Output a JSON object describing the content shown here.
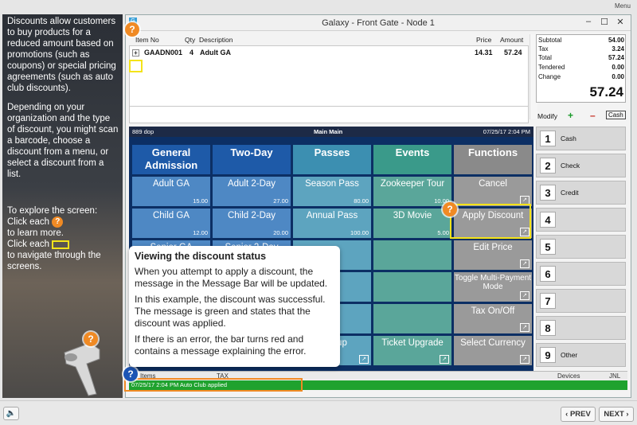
{
  "menu_link": "Menu",
  "left_panel": {
    "paragraph1": "Discounts allow customers to buy products for a reduced amount based on promotions (such as coupons) or special pricing agreements (such as auto club discounts).",
    "paragraph2": "Depending on your organization and the type of discount, you might scan a barcode, choose a discount from a menu, or select a discount from a list.",
    "explore_intro": "To explore the screen:",
    "click_each_1": "Click each",
    "learn_more": "to learn more.",
    "click_each_2": "Click each",
    "navigate": "to navigate through the screens."
  },
  "window": {
    "title": "Galaxy - Front Gate - Node 1",
    "minimize": "–",
    "maximize": "☐",
    "close": "✕"
  },
  "grid": {
    "headers": {
      "item_no": "Item No",
      "qty": "Qty",
      "description": "Description",
      "price": "Price",
      "amount": "Amount"
    },
    "rows": [
      {
        "item_no": "GAADN001",
        "qty": "4",
        "description": "Adult GA",
        "price": "14.31",
        "amount": "57.24"
      }
    ]
  },
  "totals": {
    "subtotal_label": "Subtotal",
    "subtotal": "54.00",
    "tax_label": "Tax",
    "tax": "3.24",
    "total_label": "Total",
    "total": "57.24",
    "tendered_label": "Tendered",
    "tendered": "0.00",
    "change_label": "Change",
    "change": "0.00",
    "big_total": "57.24"
  },
  "modify": {
    "label": "Modify",
    "plus": "+",
    "minus": "–",
    "cash": "Cash"
  },
  "menu_bar": {
    "left": "889 dop",
    "center": "Main Main",
    "right": "07/25/17  2:04 PM"
  },
  "tabs": [
    {
      "label": "General Admission",
      "color": "#1e5aa8"
    },
    {
      "label": "Two-Day",
      "color": "#1e5aa8"
    },
    {
      "label": "Passes",
      "color": "#3c8fb1"
    },
    {
      "label": "Events",
      "color": "#3a9a8a"
    },
    {
      "label": "Functions",
      "color": "#8a8a8a"
    }
  ],
  "products": {
    "col1": [
      {
        "label": "Adult GA",
        "price": "15.00"
      },
      {
        "label": "Child GA",
        "price": "12.00"
      },
      {
        "label": "Senior GA",
        "price": ""
      }
    ],
    "col2": [
      {
        "label": "Adult 2-Day",
        "price": "27.00"
      },
      {
        "label": "Child 2-Day",
        "price": "20.00"
      },
      {
        "label": "Senior 2-Day",
        "price": ""
      }
    ],
    "col3": [
      {
        "label": "Season Pass",
        "price": "80.00"
      },
      {
        "label": "Annual Pass",
        "price": "100.00"
      },
      {
        "label": "Lookup",
        "price": ""
      }
    ],
    "col4": [
      {
        "label": "Zookeeper Tour",
        "price": "10.00"
      },
      {
        "label": "3D Movie",
        "price": "5.00"
      },
      {
        "label": "Ticket Upgrade",
        "price": ""
      }
    ]
  },
  "functions": [
    "Cancel",
    "Apply Discount",
    "Edit Price",
    "Toggle Multi-Payment Mode",
    "Tax On/Off",
    "Select Currency"
  ],
  "fkeys": [
    {
      "num": "1",
      "label": "Cash"
    },
    {
      "num": "2",
      "label": "Check"
    },
    {
      "num": "3",
      "label": "Credit"
    },
    {
      "num": "4",
      "label": ""
    },
    {
      "num": "5",
      "label": ""
    },
    {
      "num": "6",
      "label": ""
    },
    {
      "num": "7",
      "label": ""
    },
    {
      "num": "8",
      "label": ""
    },
    {
      "num": "9",
      "label": "Other"
    }
  ],
  "status_cols": {
    "items": "Items",
    "tax": "TAX",
    "devices": "Devices",
    "jnl": "JNL"
  },
  "message_bar": "07/25/17 2:04 PM  Auto Club applied",
  "callout": {
    "title": "Viewing the discount status",
    "p1": "When you attempt to apply a discount, the message in the Message Bar will be updated.",
    "p2": "In this example, the discount was successful. The message is green and states that the discount was applied.",
    "p3": "If there is an error, the bar turns red and contains a message explaining the error."
  },
  "nav": {
    "prev": "‹ PREV",
    "next": "NEXT ›",
    "volume_icon": "🔈"
  },
  "hotspot": "?"
}
